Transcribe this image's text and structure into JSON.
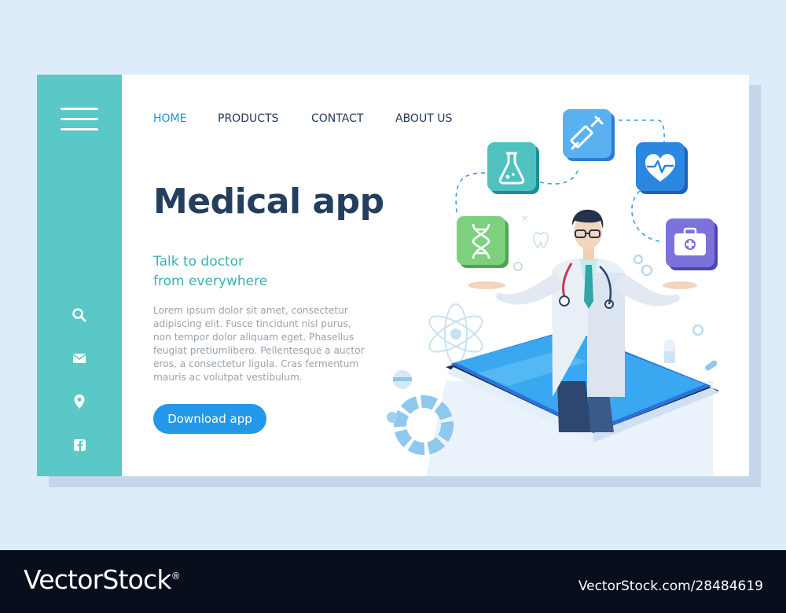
{
  "nav": {
    "items": [
      {
        "label": "HOME",
        "active": true
      },
      {
        "label": "PRODUCTS",
        "active": false
      },
      {
        "label": "CONTACT",
        "active": false
      },
      {
        "label": "ABOUT US",
        "active": false
      }
    ]
  },
  "hero": {
    "title": "Medical app",
    "subtitle_line1": "Talk to doctor",
    "subtitle_line2": "from everywhere",
    "body": "Lorem ipsum dolor sit amet, consectetur adipiscing elit. Fusce tincidunt nisl purus, non tempor dolor aliquam eget. Phasellus feugiat pretiumlibero. Pellentesque a auctor eros, a consectetur ligula. Cras fermentum mauris ac volutpat vestibulum.",
    "cta_label": "Download app"
  },
  "sidebar": {
    "icons": [
      "search-icon",
      "mail-icon",
      "location-pin-icon",
      "facebook-icon"
    ]
  },
  "illustration": {
    "icons": [
      "flask-icon",
      "syringe-icon",
      "heart-pulse-icon",
      "dna-icon",
      "first-aid-kit-icon"
    ]
  },
  "footer": {
    "brand": "VectorStock",
    "registered": "®",
    "image_id": "VectorStock.com/28484619"
  },
  "colors": {
    "sidebar": "#59c8c6",
    "title": "#243e5e",
    "accent_teal": "#36b1af",
    "button": "#2398ea",
    "nav_active": "#2290d8",
    "background": "#dcecfa",
    "footer": "#070f1c"
  }
}
